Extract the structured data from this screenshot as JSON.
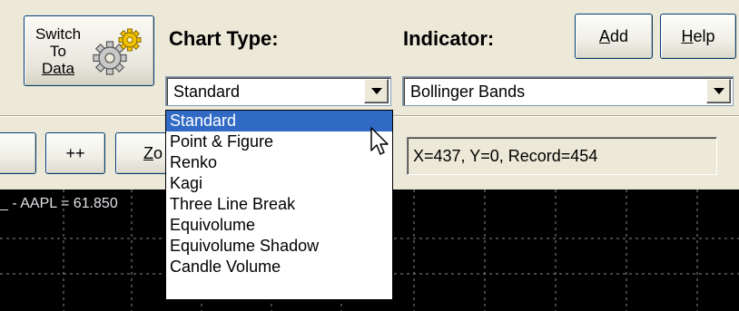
{
  "toolbar": {
    "switch_button": {
      "line1": "Switch",
      "line2": "To",
      "line3": "Data"
    },
    "chart_type_label": "Chart Type:",
    "chart_type_value": "Standard",
    "indicator_label": "Indicator:",
    "indicator_value": "Bollinger Bands",
    "add_button": "Add",
    "help_button": "Help"
  },
  "nav": {
    "plus_plus_button": "++",
    "zoom_button": "Zo",
    "readout": "X=437, Y=0, Record=454"
  },
  "chart": {
    "label": "_ - AAPL = 61.850",
    "background": "#000000",
    "grid_color": "#808080"
  },
  "chart_type_dropdown": {
    "selected_index": 0,
    "options": [
      "Standard",
      "Point & Figure",
      "Renko",
      "Kagi",
      "Three Line Break",
      "Equivolume",
      "Equivolume Shadow",
      "Candle Volume"
    ]
  },
  "colors": {
    "selection": "#316ac5",
    "button_border": "#003c74",
    "window_bg": "#ece9d8"
  }
}
